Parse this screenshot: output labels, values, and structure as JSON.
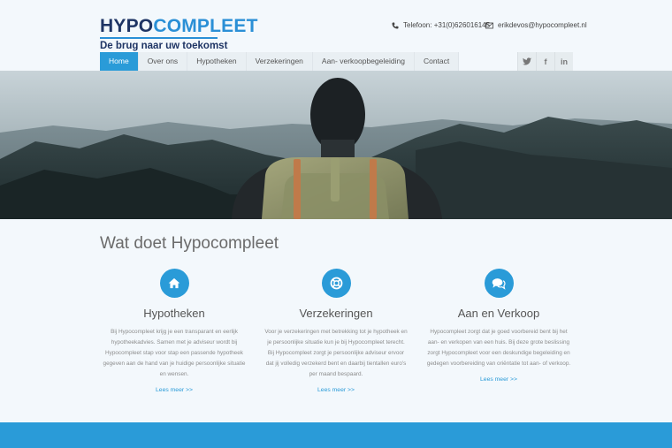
{
  "brand": {
    "part1": "HYPO",
    "part2": "COMPLEET",
    "tagline": "De brug naar uw toekomst"
  },
  "contact": {
    "phone": "Telefoon: +31(0)626016145",
    "email": "erikdevos@hypocompleet.nl"
  },
  "nav": {
    "items": [
      "Home",
      "Over ons",
      "Hypotheken",
      "Verzekeringen",
      "Aan- verkoopbegeleiding",
      "Contact"
    ],
    "active": "Home"
  },
  "social": {
    "twitter": "t",
    "facebook": "f",
    "linkedin": "in"
  },
  "main": {
    "title": "Wat doet Hypocompleet",
    "columns": [
      {
        "icon": "home-icon",
        "title": "Hypotheken",
        "text": "Bij Hypocompleet krijg je een transparant en eerlijk hypotheekadvies. Samen met je adviseur wordt bij Hypocompleet stap voor stap een passende hypotheek gegeven aan de hand van je huidige persoonlijke situatie en wensen.",
        "link": "Lees meer >>"
      },
      {
        "icon": "lifebuoy-icon",
        "title": "Verzekeringen",
        "text": "Voor je verzekeringen met betrekking tot je hypotheek en je persoonlijke situatie kun je bij Hypocompleet terecht. Bij Hypocompleet zorgt je persoonlijke adviseur ervoor dat jij volledig verzekerd bent en daarbij tientallen euro's per maand bespaard.",
        "link": "Lees meer >>"
      },
      {
        "icon": "chat-icon",
        "title": "Aan en Verkoop",
        "text": "Hypocompleet zorgt dat je goed voorbereid bent bij het aan- en verkopen van een huis. Bij deze grote beslissing zorgt Hypocompleet voor een deskundige begeleiding en gedegen voorbereiding van oriëntatie tot aan- of verkoop.",
        "link": "Lees meer >>"
      }
    ]
  },
  "colors": {
    "accent": "#2a9bd8",
    "brand_dark": "#1e3464",
    "background": "#f3f8fc"
  }
}
